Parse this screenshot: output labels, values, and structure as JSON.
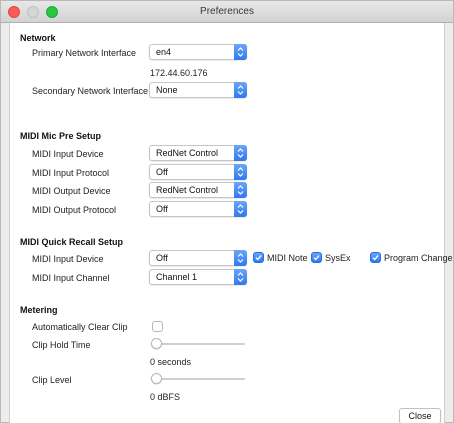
{
  "window": {
    "title": "Preferences"
  },
  "network": {
    "heading": "Network",
    "primary_label": "Primary Network Interface",
    "primary_value": "en4",
    "ip_address": "172.44.60.176",
    "secondary_label": "Secondary Network Interface",
    "secondary_value": "None"
  },
  "mic_pre": {
    "heading": "MIDI Mic Pre Setup",
    "input_device_label": "MIDI Input Device",
    "input_device_value": "RedNet Control",
    "input_protocol_label": "MIDI Input Protocol",
    "input_protocol_value": "Off",
    "output_device_label": "MIDI Output Device",
    "output_device_value": "RedNet Control",
    "output_protocol_label": "MIDI Output Protocol",
    "output_protocol_value": "Off"
  },
  "quick_recall": {
    "heading": "MIDI Quick Recall Setup",
    "input_device_label": "MIDI Input Device",
    "input_device_value": "Off",
    "checkboxes": [
      {
        "label": "MIDI Note",
        "checked": true
      },
      {
        "label": "SysEx",
        "checked": true
      },
      {
        "label": "Program Change",
        "checked": true
      }
    ],
    "input_channel_label": "MIDI Input Channel",
    "input_channel_value": "Channel 1"
  },
  "metering": {
    "heading": "Metering",
    "auto_clear_label": "Automatically Clear Clip",
    "auto_clear_checked": false,
    "clip_hold_label": "Clip Hold Time",
    "clip_hold_level": 0,
    "clip_hold_readout": "0 seconds",
    "clip_level_label": "Clip Level",
    "clip_level_level": 0,
    "clip_level_readout": "0 dBFS"
  },
  "footer": {
    "close_label": "Close"
  },
  "colors": {
    "accent": "#3b82f6",
    "close": "#fc5b57",
    "zoom": "#2bc640"
  }
}
